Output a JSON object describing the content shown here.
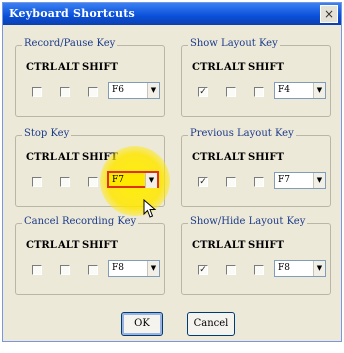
{
  "window": {
    "title": "Keyboard Shortcuts",
    "close_glyph": "×"
  },
  "modifiers": [
    "CTRL",
    "ALT",
    "SHIFT"
  ],
  "groups": [
    {
      "title": "Record/Pause Key",
      "ctrl": false,
      "alt": false,
      "shift": false,
      "key": "F6"
    },
    {
      "title": "Stop Key",
      "ctrl": false,
      "alt": false,
      "shift": false,
      "key": "F7"
    },
    {
      "title": "Cancel Recording Key",
      "ctrl": false,
      "alt": false,
      "shift": false,
      "key": "F8"
    },
    {
      "title": "Show Layout Key",
      "ctrl": true,
      "alt": false,
      "shift": false,
      "key": "F4"
    },
    {
      "title": "Previous Layout Key",
      "ctrl": true,
      "alt": false,
      "shift": false,
      "key": "F7"
    },
    {
      "title": "Show/Hide Layout Key",
      "ctrl": true,
      "alt": false,
      "shift": false,
      "key": "F8"
    }
  ],
  "buttons": {
    "ok": "OK",
    "cancel": "Cancel"
  },
  "check_glyph": "✓",
  "dropdown_arrow": "▼",
  "highlight_color": "#ffe800"
}
